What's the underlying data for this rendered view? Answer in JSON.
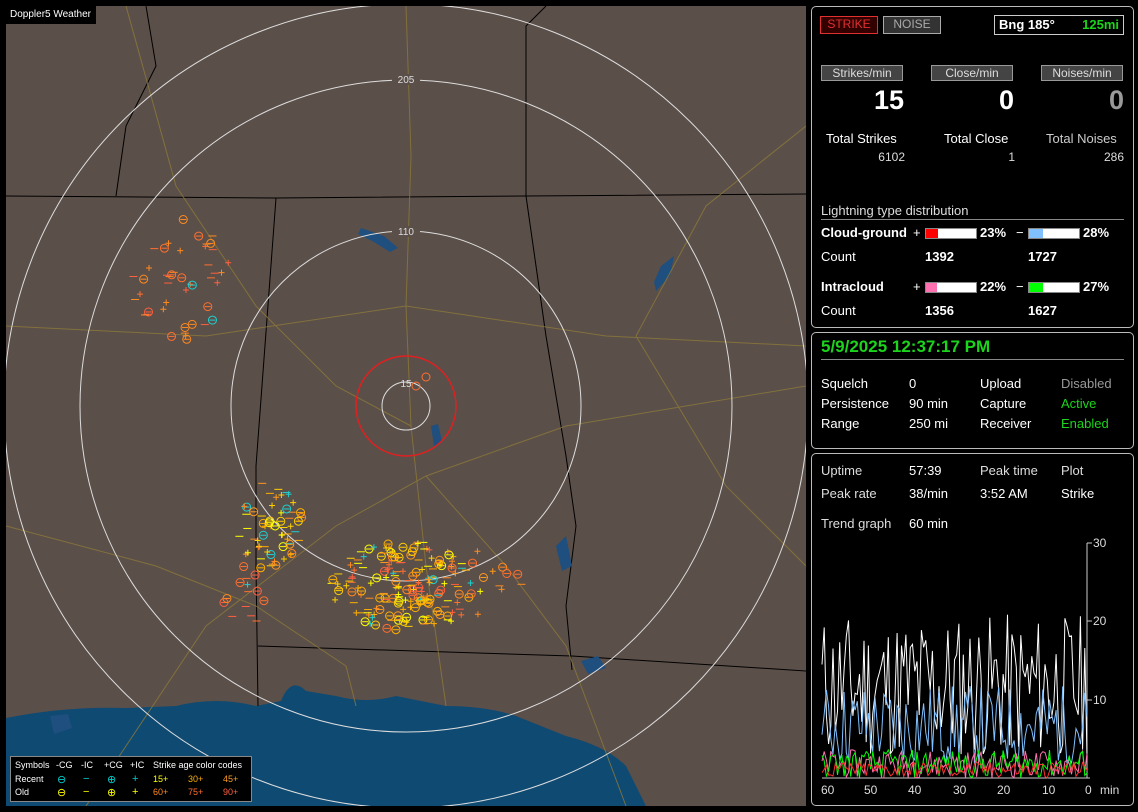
{
  "map": {
    "title": "Doppler5 Weather",
    "range_labels": {
      "outer": "205",
      "middle": "110",
      "inner": "15"
    },
    "legend": {
      "symbols_label": "Symbols",
      "cols": [
        "-CG",
        "-IC",
        "+CG",
        "+IC"
      ],
      "recent_label": "Recent",
      "old_label": "Old",
      "age_title": "Strike age color codes",
      "recent_ages": [
        "15+",
        "30+",
        "45+"
      ],
      "old_ages": [
        "60+",
        "75+",
        "90+"
      ],
      "recent_symbols": [
        "⊖",
        "−",
        "⊕",
        "+"
      ],
      "old_symbols": [
        "⊖",
        "−",
        "⊕",
        "+"
      ]
    }
  },
  "status": {
    "strike_button": "STRIKE",
    "noise_button": "NOISE",
    "bearing": "Bng 185°",
    "distance": "125mi"
  },
  "rates": {
    "strikes_label": "Strikes/min",
    "close_label": "Close/min",
    "noises_label": "Noises/min",
    "strikes_value": "15",
    "close_value": "0",
    "noises_value": "0"
  },
  "totals": {
    "strikes_label": "Total Strikes",
    "close_label": "Total Close",
    "noises_label": "Total Noises",
    "strikes": "6102",
    "close": "1",
    "noises": "286"
  },
  "distribution": {
    "title": "Lightning type distribution",
    "cg_label": "Cloud-ground",
    "ic_label": "Intracloud",
    "count_label": "Count",
    "plus": "+",
    "minus": "−",
    "cg_pos_pct": "23%",
    "cg_neg_pct": "28%",
    "ic_pos_pct": "22%",
    "ic_neg_pct": "27%",
    "cg_pos_fraction": 0.23,
    "cg_neg_fraction": 0.28,
    "ic_pos_fraction": 0.22,
    "ic_neg_fraction": 0.27,
    "cg_pos_count": "1392",
    "cg_neg_count": "1727",
    "ic_pos_count": "1356",
    "ic_neg_count": "1627",
    "colors": {
      "cg_pos": "#ff0000",
      "cg_neg": "#80c0ff",
      "ic_pos": "#ff70b0",
      "ic_neg": "#00ff00"
    }
  },
  "settings": {
    "datetime": "5/9/2025 12:37:17 PM",
    "squelch_label": "Squelch",
    "squelch": "0",
    "persistence_label": "Persistence",
    "persistence": "90 min",
    "range_label": "Range",
    "range": "250 mi",
    "upload_label": "Upload",
    "upload": "Disabled",
    "capture_label": "Capture",
    "capture": "Active",
    "receiver_label": "Receiver",
    "receiver": "Enabled"
  },
  "stats": {
    "uptime_label": "Uptime",
    "uptime": "57:39",
    "peak_time_label": "Peak time",
    "peak_time": "3:52 AM",
    "plot_label": "Plot",
    "plot": "Strike",
    "peak_rate_label": "Peak rate",
    "peak_rate": "38/min",
    "trend_label": "Trend graph",
    "trend": "60 min",
    "graph_y_ticks": [
      "30",
      "20",
      "10",
      "0"
    ],
    "graph_x_ticks": [
      "60",
      "50",
      "40",
      "30",
      "20",
      "10",
      "0"
    ],
    "graph_x_unit": "min"
  }
}
